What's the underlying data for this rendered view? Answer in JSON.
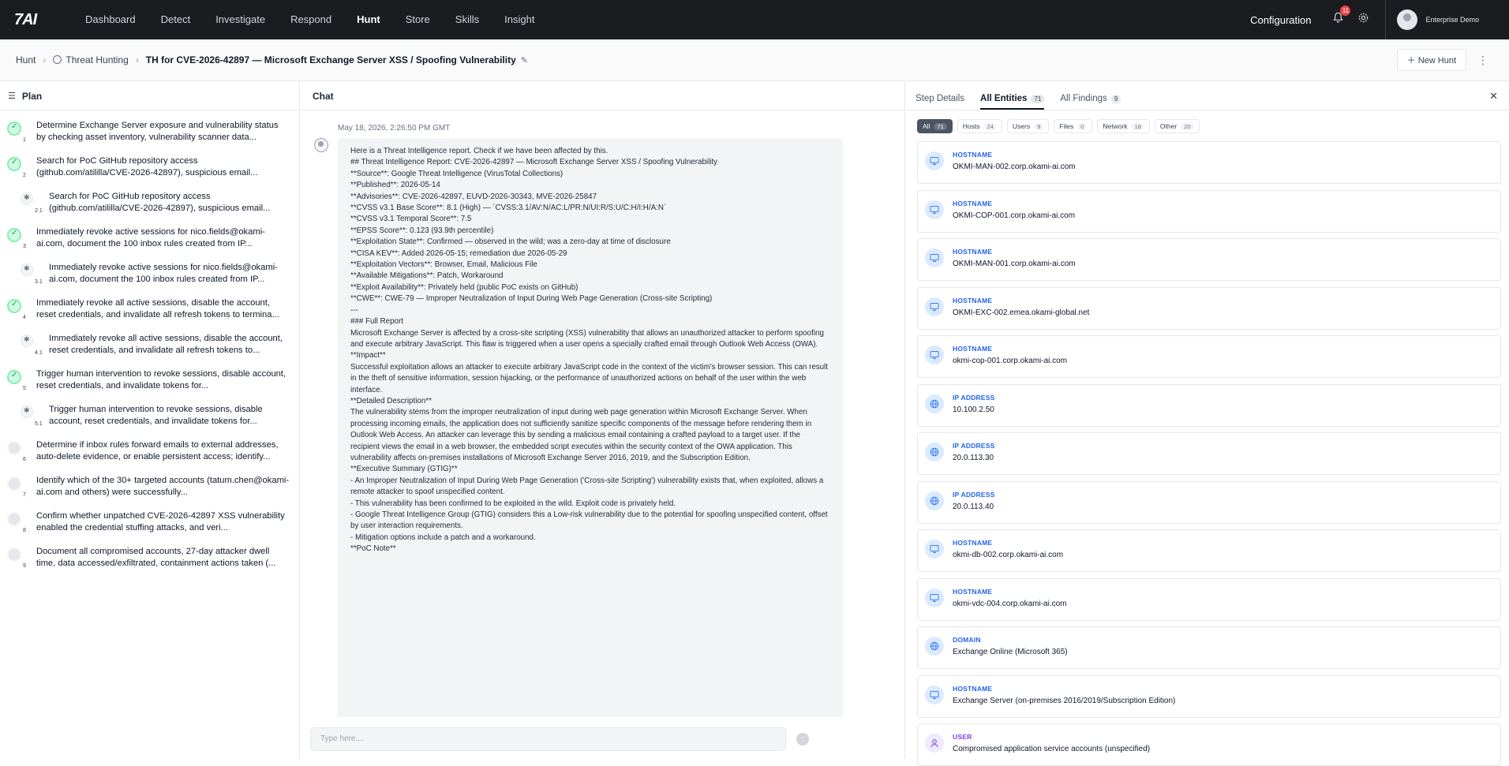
{
  "topnav": {
    "logo": "7AI",
    "items": [
      "Dashboard",
      "Detect",
      "Investigate",
      "Respond",
      "Hunt",
      "Store",
      "Skills",
      "Insight"
    ],
    "active": "Hunt",
    "configuration": "Configuration",
    "notification_count": "11",
    "user": "Enterprise Demo"
  },
  "breadcrumb": {
    "root": "Hunt",
    "section": "Threat Hunting",
    "title": "TH for CVE-2026-42897 — Microsoft Exchange Server XSS / Spoofing Vulnerability",
    "new_hunt": "New Hunt"
  },
  "plan": {
    "title": "Plan",
    "items": [
      {
        "num": "1",
        "status": "done",
        "sub": false,
        "text": "Determine Exchange Server exposure and vulnerability status by checking asset inventory, vulnerability scanner data..."
      },
      {
        "num": "2",
        "status": "done",
        "sub": false,
        "text": "Search for PoC GitHub repository access (github.com/atililla/CVE-2026-42897), suspicious email..."
      },
      {
        "num": "2.1",
        "status": "sub",
        "sub": true,
        "text": "Search for PoC GitHub repository access (github.com/atililla/CVE-2026-42897), suspicious email..."
      },
      {
        "num": "3",
        "status": "done",
        "sub": false,
        "text": "Immediately revoke active sessions for nico.fields@okami-ai.com, document the 100 inbox rules created from IP..."
      },
      {
        "num": "3.1",
        "status": "sub",
        "sub": true,
        "text": "Immediately revoke active sessions for nico.fields@okami-ai.com, document the 100 inbox rules created from IP..."
      },
      {
        "num": "4",
        "status": "done",
        "sub": false,
        "text": "Immediately revoke all active sessions, disable the account, reset credentials, and invalidate all refresh tokens to termina..."
      },
      {
        "num": "4.1",
        "status": "sub",
        "sub": true,
        "text": "Immediately revoke all active sessions, disable the account, reset credentials, and invalidate all refresh tokens to..."
      },
      {
        "num": "5",
        "status": "done",
        "sub": false,
        "text": "Trigger human intervention to revoke sessions, disable account, reset credentials, and invalidate tokens for..."
      },
      {
        "num": "5.1",
        "status": "sub",
        "sub": true,
        "text": "Trigger human intervention to revoke sessions, disable account, reset credentials, and invalidate tokens for..."
      },
      {
        "num": "6",
        "status": "pending",
        "sub": false,
        "text": "Determine if inbox rules forward emails to external addresses, auto-delete evidence, or enable persistent access; identify..."
      },
      {
        "num": "7",
        "status": "pending",
        "sub": false,
        "text": "Identify which of the 30+ targeted accounts (tatum.chen@okami-ai.com and others) were successfully..."
      },
      {
        "num": "8",
        "status": "pending",
        "sub": false,
        "text": "Confirm whether unpatched CVE-2026-42897 XSS vulnerability enabled the credential stuffing attacks, and veri..."
      },
      {
        "num": "9",
        "status": "pending",
        "sub": false,
        "text": "Document all compromised accounts, 27-day attacker dwell time, data accessed/exfiltrated, containment actions taken (..."
      }
    ]
  },
  "chat": {
    "title": "Chat",
    "timestamp": "May 18, 2026, 2:26:50 PM GMT",
    "message_lines": [
      "Here is a Threat Intelligence report. Check if we have been affected by this.",
      "",
      "## Threat Intelligence Report: CVE-2026-42897 — Microsoft Exchange Server XSS / Spoofing Vulnerability",
      "",
      "**Source**: Google Threat Intelligence (VirusTotal Collections)",
      "**Published**: 2026-05-14",
      "**Advisories**: CVE-2026-42897, EUVD-2026-30343, MVE-2026-25847",
      "**CVSS v3.1 Base Score**: 8.1 (High) — `CVSS:3.1/AV:N/AC:L/PR:N/UI:R/S:U/C:H/I:H/A:N`",
      "**CVSS v3.1 Temporal Score**: 7.5",
      "**EPSS Score**: 0.123 (93.9th percentile)",
      "**Exploitation State**: Confirmed — observed in the wild; was a zero-day at time of disclosure",
      "**CISA KEV**: Added 2026-05-15; remediation due 2026-05-29",
      "**Exploitation Vectors**: Browser, Email, Malicious File",
      "**Available Mitigations**: Patch, Workaround",
      "**Exploit Availability**: Privately held (public PoC exists on GitHub)",
      "**CWE**: CWE-79 — Improper Neutralization of Input During Web Page Generation (Cross-site Scripting)",
      "",
      "---",
      "",
      "### Full Report",
      "",
      "Microsoft Exchange Server is affected by a cross-site scripting (XSS) vulnerability that allows an unauthorized attacker to perform spoofing and execute arbitrary JavaScript. This flaw is triggered when a user opens a specially crafted email through Outlook Web Access (OWA).",
      "",
      "**Impact**",
      "",
      "Successful exploitation allows an attacker to execute arbitrary JavaScript code in the context of the victim's browser session. This can result in the theft of sensitive information, session hijacking, or the performance of unauthorized actions on behalf of the user within the web interface.",
      "",
      "**Detailed Description**",
      "",
      "The vulnerability stems from the improper neutralization of input during web page generation within Microsoft Exchange Server. When processing incoming emails, the application does not sufficiently sanitize specific components of the message before rendering them in Outlook Web Access. An attacker can leverage this by sending a malicious email containing a crafted payload to a target user. If the recipient views the email in a web browser, the embedded script executes within the security context of the OWA application. This vulnerability affects on-premises installations of Microsoft Exchange Server 2016, 2019, and the Subscription Edition.",
      "",
      "**Executive Summary (GTIG)**",
      "",
      "- An Improper Neutralization of Input During Web Page Generation ('Cross-site Scripting') vulnerability exists that, when exploited, allows a remote attacker to spoof unspecified content.",
      "- This vulnerability has been confirmed to be exploited in the wild. Exploit code is privately held.",
      "- Google Threat Intelligence Group (GTIG) considers this a Low-risk vulnerability due to the potential for spoofing unspecified content, offset by user interaction requirements.",
      "- Mitigation options include a patch and a workaround.",
      "",
      "**PoC Note**"
    ],
    "composer_placeholder": "Type here....",
    "send_icon": "arrow-up-icon"
  },
  "right_panel": {
    "tabs": [
      {
        "label": "Step Details",
        "count": ""
      },
      {
        "label": "All Entities",
        "count": "71"
      },
      {
        "label": "All Findings",
        "count": "9"
      }
    ],
    "filters": [
      {
        "label": "All",
        "count": "71"
      },
      {
        "label": "Hosts",
        "count": "24"
      },
      {
        "label": "Users",
        "count": "9"
      },
      {
        "label": "Files",
        "count": "0"
      },
      {
        "label": "Network",
        "count": "18"
      },
      {
        "label": "Other",
        "count": "20"
      }
    ],
    "entities": [
      {
        "type": "HOSTNAME",
        "value": "OKMI-MAN-002.corp.okami-ai.com",
        "icon": "monitor"
      },
      {
        "type": "HOSTNAME",
        "value": "OKMI-COP-001.corp.okami-ai.com",
        "icon": "monitor"
      },
      {
        "type": "HOSTNAME",
        "value": "OKMI-MAN-001.corp.okami-ai.com",
        "icon": "monitor"
      },
      {
        "type": "HOSTNAME",
        "value": "OKMI-EXC-002.emea.okami-global.net",
        "icon": "monitor"
      },
      {
        "type": "HOSTNAME",
        "value": "okmi-cop-001.corp.okami-ai.com",
        "icon": "monitor"
      },
      {
        "type": "IP ADDRESS",
        "value": "10.100.2.50",
        "icon": "globe"
      },
      {
        "type": "IP ADDRESS",
        "value": "20.0.113.30",
        "icon": "globe"
      },
      {
        "type": "IP ADDRESS",
        "value": "20.0.113.40",
        "icon": "globe"
      },
      {
        "type": "HOSTNAME",
        "value": "okmi-db-002.corp.okami-ai.com",
        "icon": "monitor"
      },
      {
        "type": "HOSTNAME",
        "value": "okmi-vdc-004.corp.okami-ai.com",
        "icon": "monitor"
      },
      {
        "type": "DOMAIN",
        "value": "Exchange Online (Microsoft 365)",
        "icon": "globe"
      },
      {
        "type": "HOSTNAME",
        "value": "Exchange Server (on-premises 2016/2019/Subscription Edition)",
        "icon": "monitor"
      },
      {
        "type": "USER",
        "value": "Compromised application service accounts (unspecified)",
        "icon": "user"
      }
    ]
  },
  "colors": {
    "topbar": "#1b1c20",
    "accent_blue": "#2563eb",
    "user_purple": "#7c3aed",
    "done_green": "#16a34a",
    "badge_red": "#ef4444"
  }
}
